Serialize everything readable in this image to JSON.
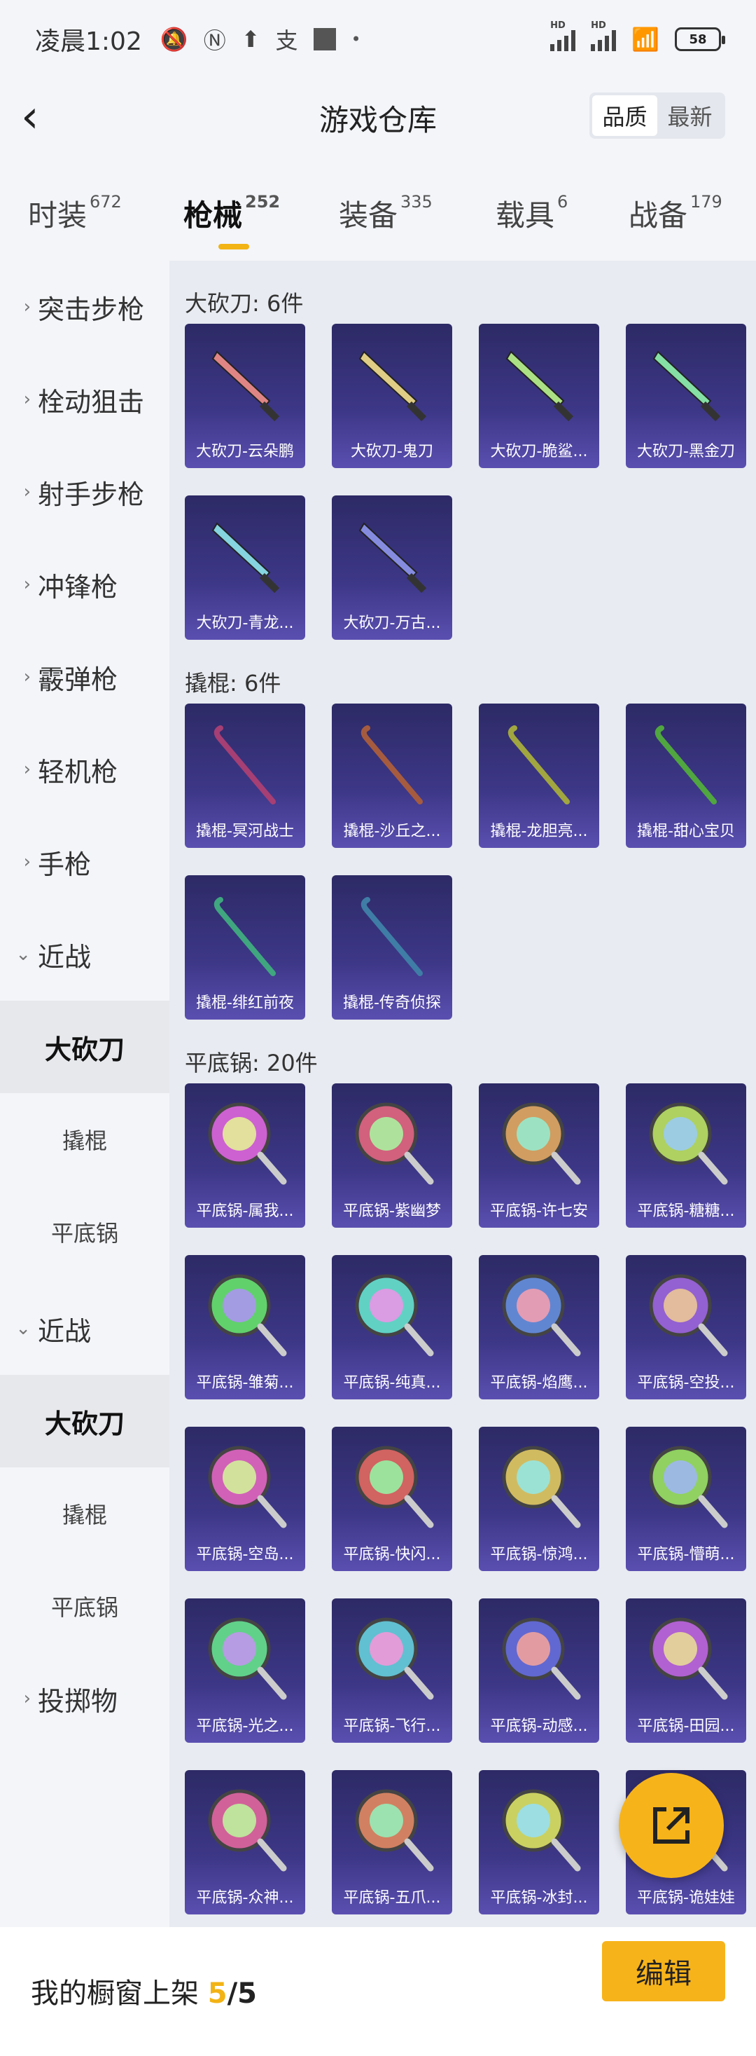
{
  "status_bar": {
    "time": "凌晨1:02",
    "battery": "58"
  },
  "header": {
    "back_icon": "back-arrow-icon",
    "title": "游戏仓库",
    "sort_quality": "品质",
    "sort_latest": "最新"
  },
  "tabs": [
    {
      "label": "时装",
      "count": "672"
    },
    {
      "label": "枪械",
      "count": "252"
    },
    {
      "label": "装备",
      "count": "335"
    },
    {
      "label": "载具",
      "count": "6"
    },
    {
      "label": "战备",
      "count": "179"
    }
  ],
  "sidebar": {
    "categories": [
      "突击步枪",
      "栓动狙击",
      "射手步枪",
      "冲锋枪",
      "霰弹枪",
      "轻机枪",
      "手枪",
      "近战"
    ],
    "sub1": [
      "大砍刀",
      "撬棍",
      "平底锅"
    ],
    "category_melee2": "近战",
    "sub2": [
      "大砍刀",
      "撬棍",
      "平底锅"
    ],
    "category_throw": "投掷物"
  },
  "sections": [
    {
      "title": "大砍刀: 6件",
      "items": [
        "大砍刀-云朵鹏",
        "大砍刀-鬼刀",
        "大砍刀-脆鲨...",
        "大砍刀-黑金刀",
        "大砍刀-青龙...",
        "大砍刀-万古..."
      ]
    },
    {
      "title": "撬棍: 6件",
      "items": [
        "撬棍-冥河战士",
        "撬棍-沙丘之...",
        "撬棍-龙胆亮...",
        "撬棍-甜心宝贝",
        "撬棍-绯红前夜",
        "撬棍-传奇侦探"
      ]
    },
    {
      "title": "平底锅: 20件",
      "items": [
        "平底锅-属我...",
        "平底锅-紫幽梦",
        "平底锅-许七安",
        "平底锅-糖糖...",
        "平底锅-雏菊...",
        "平底锅-纯真...",
        "平底锅-焰鹰...",
        "平底锅-空投...",
        "平底锅-空岛...",
        "平底锅-快闪...",
        "平底锅-惊鸿...",
        "平底锅-懵萌...",
        "平底锅-光之...",
        "平底锅-飞行...",
        "平底锅-动感...",
        "平底锅-田园...",
        "平底锅-众神...",
        "平底锅-五爪...",
        "平底锅-冰封...",
        "平底锅-诡娃娃"
      ]
    }
  ],
  "fab_icon": "share-external-icon",
  "bottom": {
    "label": "我的橱窗上架 ",
    "count": "5",
    "total": "/5",
    "edit": "编辑"
  },
  "colors": {
    "accent": "#f7b31a",
    "card": "#3d3787"
  }
}
